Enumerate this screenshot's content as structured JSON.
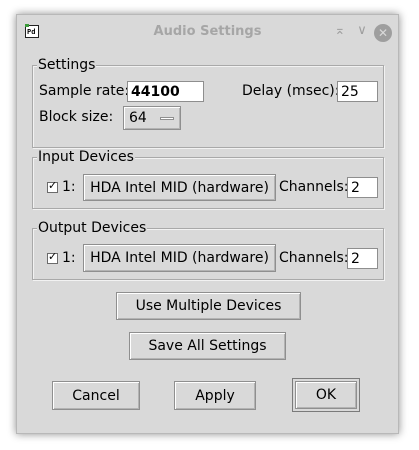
{
  "window": {
    "title": "Audio Settings",
    "app_icon_text": "Pd"
  },
  "titlebar_buttons": {
    "shade": "⌅",
    "minimize": "∨",
    "close": "✕"
  },
  "settings": {
    "group_label": "Settings",
    "sample_rate_label": "Sample rate:",
    "sample_rate_value": "44100",
    "delay_label": "Delay (msec):",
    "delay_value": "25",
    "block_size_label": "Block size:",
    "block_size_value": "64"
  },
  "input_devices": {
    "group_label": "Input Devices",
    "index_label": "1:",
    "checked": true,
    "device_button": "HDA Intel MID (hardware)",
    "channels_label": "Channels:",
    "channels_value": "2"
  },
  "output_devices": {
    "group_label": "Output Devices",
    "index_label": "1:",
    "checked": true,
    "device_button": "HDA Intel MID (hardware)",
    "channels_label": "Channels:",
    "channels_value": "2"
  },
  "actions": {
    "use_multiple_devices": "Use Multiple Devices",
    "save_all_settings": "Save All Settings",
    "cancel": "Cancel",
    "apply": "Apply",
    "ok": "OK"
  }
}
